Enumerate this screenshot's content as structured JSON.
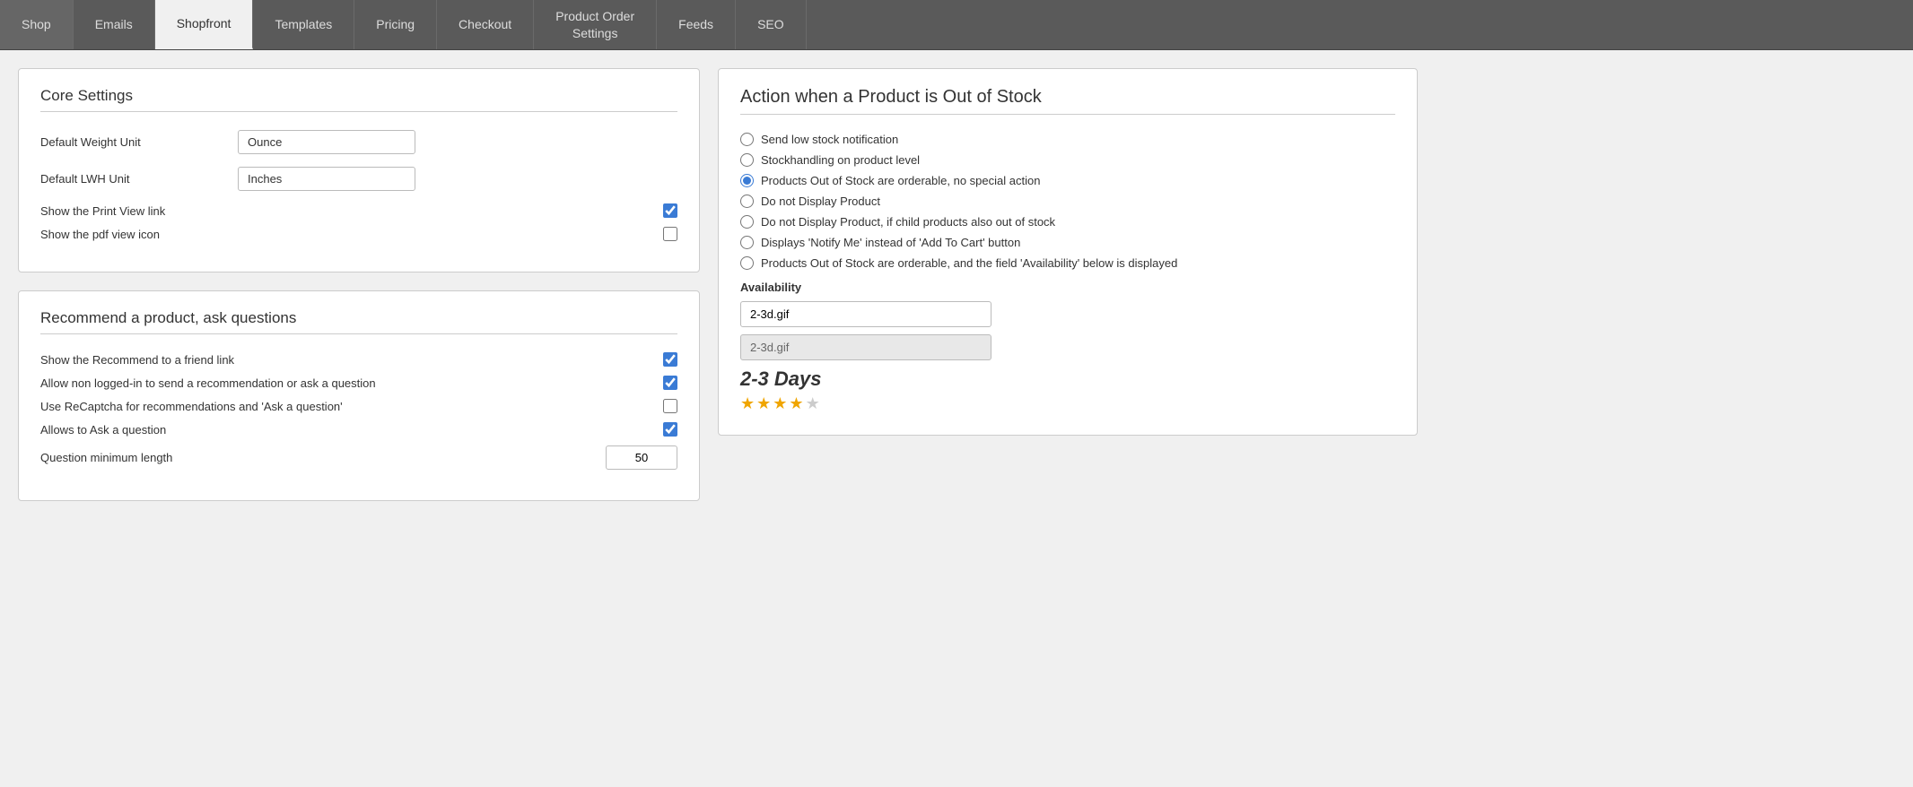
{
  "nav": {
    "tabs": [
      {
        "id": "shop",
        "label": "Shop",
        "active": false
      },
      {
        "id": "emails",
        "label": "Emails",
        "active": false
      },
      {
        "id": "shopfront",
        "label": "Shopfront",
        "active": true
      },
      {
        "id": "templates",
        "label": "Templates",
        "active": false
      },
      {
        "id": "pricing",
        "label": "Pricing",
        "active": false
      },
      {
        "id": "checkout",
        "label": "Checkout",
        "active": false
      },
      {
        "id": "product-order-settings",
        "label": "Product Order\nSettings",
        "active": false
      },
      {
        "id": "feeds",
        "label": "Feeds",
        "active": false
      },
      {
        "id": "seo",
        "label": "SEO",
        "active": false
      }
    ]
  },
  "core_settings": {
    "title": "Core Settings",
    "default_weight_unit_label": "Default Weight Unit",
    "default_weight_unit_value": "Ounce",
    "default_lwh_unit_label": "Default LWH Unit",
    "default_lwh_unit_value": "Inches",
    "show_print_view_label": "Show the Print View link",
    "show_pdf_view_label": "Show the pdf view icon"
  },
  "recommend": {
    "title": "Recommend a product, ask questions",
    "show_recommend_label": "Show the Recommend to a friend link",
    "allow_non_logged_label": "Allow non logged-in to send a recommendation or ask a question",
    "use_recaptcha_label": "Use ReCaptcha for recommendations and 'Ask a question'",
    "allows_ask_label": "Allows to Ask a question",
    "question_min_length_label": "Question minimum length",
    "question_min_length_value": "50"
  },
  "out_of_stock": {
    "title": "Action when a Product is Out of Stock",
    "options": [
      {
        "id": "low-stock",
        "label": "Send low stock notification",
        "checked": false
      },
      {
        "id": "stockhandling",
        "label": "Stockhandling on product level",
        "checked": false
      },
      {
        "id": "orderable-no-action",
        "label": "Products Out of Stock are orderable, no special action",
        "checked": true
      },
      {
        "id": "do-not-display",
        "label": "Do not Display Product",
        "checked": false
      },
      {
        "id": "do-not-display-child",
        "label": "Do not Display Product, if child products also out of stock",
        "checked": false
      },
      {
        "id": "notify-me",
        "label": "Displays 'Notify Me' instead of 'Add To Cart' button",
        "checked": false
      },
      {
        "id": "orderable-availability",
        "label": "Products Out of Stock are orderable, and the field 'Availability' below is displayed",
        "checked": false
      }
    ],
    "availability_label": "Availability",
    "availability_input_1": "2-3d.gif",
    "availability_input_2": "2-3d.gif",
    "days_text": "2-3 Days",
    "stars": [
      true,
      true,
      true,
      true,
      false
    ]
  }
}
